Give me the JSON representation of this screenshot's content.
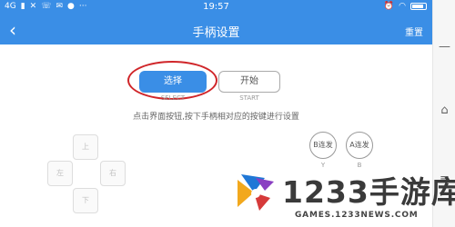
{
  "status_bar": {
    "network": "4G",
    "time": "19:57",
    "left_icons": [
      "signal-icon",
      "mute-icon",
      "phone-icon",
      "message-icon",
      "chat-icon",
      "more-dots-icon"
    ],
    "right_icons": [
      "alarm-icon",
      "wifi-icon",
      "battery-icon"
    ]
  },
  "toolbar": {
    "back_glyph": "‹",
    "title": "手柄设置",
    "reset_label": "重置"
  },
  "buttons": {
    "select_label": "选择",
    "select_caption": "SELECT",
    "start_label": "开始",
    "start_caption": "START"
  },
  "hint_text": "点击界面按钮,按下手柄相对应的按键进行设置",
  "dpad": {
    "up": "上",
    "left": "左",
    "right": "右",
    "down": "下"
  },
  "action_buttons": {
    "b_label": "B连发",
    "b_caption": "Y",
    "a_label": "A连发",
    "a_caption": "B"
  },
  "side_nav": {
    "home_glyph": "—",
    "back_glyph": "⌂",
    "menu_glyph": "≡"
  },
  "watermark": {
    "brand": "1233手游库",
    "url": "GAMES.1233NEWS.COM"
  },
  "colors": {
    "primary": "#3a8ee6",
    "highlight": "#d0262a"
  }
}
